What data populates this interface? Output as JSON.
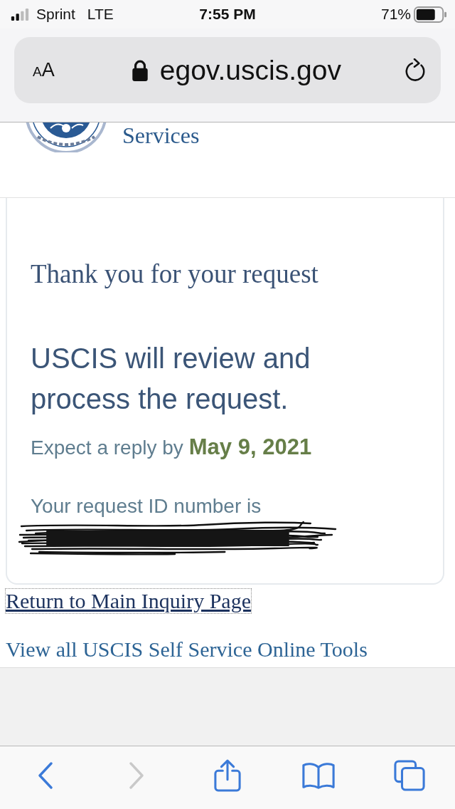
{
  "status_bar": {
    "carrier": "Sprint",
    "network": "LTE",
    "time": "7:55 PM",
    "battery": "71%"
  },
  "address_bar": {
    "text_size_label": "AA",
    "url": "egov.uscis.gov"
  },
  "site_header": {
    "agency_name_fragment": "Services"
  },
  "confirmation": {
    "title": "Thank you for your request",
    "message": "USCIS will review and process the request.",
    "reply_text": "Expect a reply by",
    "reply_date": "May 9, 2021",
    "request_id_label": "Your request ID number is",
    "request_id_redacted": true
  },
  "links": [
    {
      "label": "Return to Main Inquiry Page",
      "focused": true
    },
    {
      "label": "View all USCIS Self Service Online Tools",
      "focused": false
    }
  ],
  "toolbar": [
    {
      "kind": "back",
      "disabled": false
    },
    {
      "kind": "forward",
      "disabled": true
    },
    {
      "kind": "share",
      "disabled": false
    },
    {
      "kind": "bookmarks",
      "disabled": false
    },
    {
      "kind": "tabs",
      "disabled": false
    }
  ]
}
